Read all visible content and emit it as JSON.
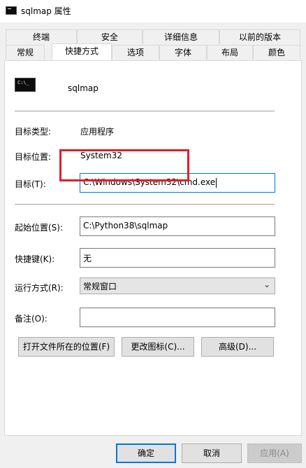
{
  "window": {
    "title": "sqlmap 属性"
  },
  "tabs": {
    "row1": [
      "终端",
      "安全",
      "详细信息",
      "以前的版本"
    ],
    "row2": [
      "常规",
      "快捷方式",
      "选项",
      "字体",
      "布局",
      "颜色"
    ],
    "active": "快捷方式"
  },
  "shortcut": {
    "name": "sqlmap",
    "icon": "console-icon",
    "icon_glyph": "C:\\_",
    "target_type_label": "目标类型:",
    "target_type": "应用程序",
    "target_location_label": "目标位置:",
    "target_location": "System32",
    "target_label": "目标(T):",
    "target": "C:\\Windows\\System32\\cmd.exe",
    "start_in_label": "起始位置(S):",
    "start_in": "C:\\Python38\\sqlmap",
    "hotkey_label": "快捷键(K):",
    "hotkey": "无",
    "run_label": "运行方式(R):",
    "run": "常规窗口",
    "comment_label": "备注(O):",
    "comment": ""
  },
  "actions": {
    "open_location": "打开文件所在的位置(F)",
    "change_icon": "更改图标(C)...",
    "advanced": "高级(D)..."
  },
  "footer": {
    "ok": "确定",
    "cancel": "取消",
    "apply": "应用(A)"
  },
  "colors": {
    "annotation": "#e41e26",
    "focus": "#0078d7"
  }
}
